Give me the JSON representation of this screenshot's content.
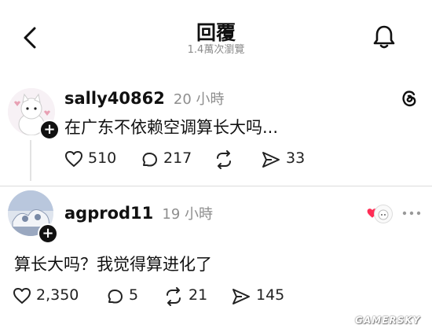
{
  "header": {
    "title": "回覆",
    "views": "1.4萬次瀏覽"
  },
  "posts": [
    {
      "username": "sally40862",
      "time": "20 小時",
      "text": "在广东不依赖空调算长大吗...",
      "likes": "510",
      "comments": "217",
      "reposts": "",
      "shares": "33"
    },
    {
      "username": "agprod11",
      "time": "19 小時",
      "text": "算长大吗？我觉得算进化了",
      "likes": "2,350",
      "comments": "5",
      "reposts": "21",
      "shares": "145"
    }
  ],
  "watermark": "GAMERSKY",
  "icons": {
    "back": "chevron-left-icon",
    "notify": "bell-icon",
    "threads": "threads-logo-icon",
    "like": "heart-icon",
    "comment": "comment-icon",
    "repost": "repost-icon",
    "share": "send-icon",
    "more": "more-icon"
  },
  "colors": {
    "accent_heart": "#ff2d55",
    "text_primary": "#111111",
    "text_secondary": "#8e8e8e"
  }
}
